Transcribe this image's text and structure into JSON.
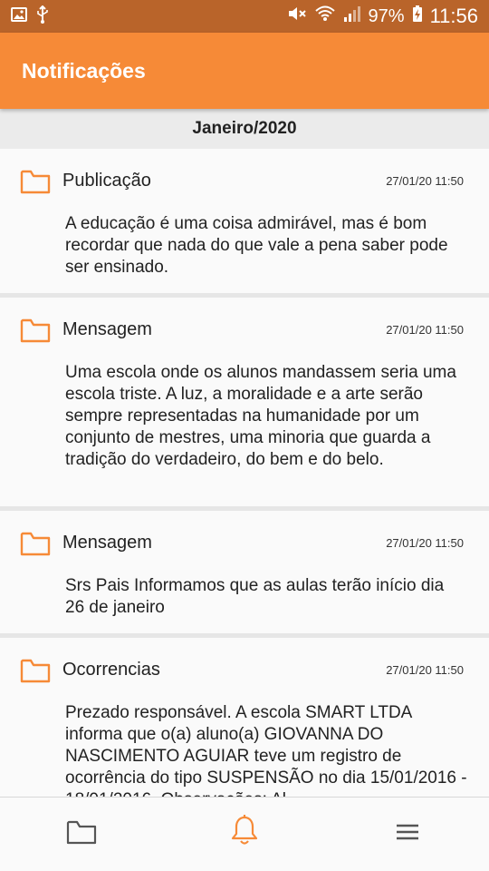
{
  "status_bar": {
    "battery_percent": "97%",
    "time": "11:56",
    "icons": [
      "image-icon",
      "usb-icon",
      "mute-icon",
      "wifi-icon",
      "signal-icon",
      "battery-charging-icon"
    ]
  },
  "app_bar": {
    "title": "Notificações",
    "color": "#f68a37"
  },
  "month_header": "Janeiro/2020",
  "notifications": [
    {
      "type": "Publicação",
      "date": "27/01/20 11:50",
      "icon": "folder-icon",
      "text": "A educação é uma coisa admirável, mas é bom recordar que nada do que vale a pena saber pode ser ensinado."
    },
    {
      "type": "Mensagem",
      "date": "27/01/20 11:50",
      "icon": "folder-icon",
      "text": "Uma escola onde os alunos mandassem seria uma escola triste. A luz, a moralidade e a arte serão sempre representadas na humanidade por um conjunto de mestres, uma minoria que guarda a tradição do verdadeiro, do bem e do belo."
    },
    {
      "type": "Mensagem",
      "date": "27/01/20 11:50",
      "icon": "folder-icon",
      "text": "Srs Pais Informamos que as aulas terão início dia 26 de janeiro"
    },
    {
      "type": "Ocorrencias",
      "date": "27/01/20 11:50",
      "icon": "folder-icon",
      "text": "Prezado responsável. A escola SMART LTDA informa que o(a) aluno(a) GIOVANNA DO NASCIMENTO AGUIAR teve um registro de ocorrência do tipo SUSPENSÃO no dia 15/01/2016 - 18/01/2016. Observações: Al"
    }
  ],
  "bottom_nav": {
    "items": [
      "folder-icon",
      "bell-icon",
      "menu-icon"
    ],
    "active": "bell-icon"
  },
  "colors": {
    "accent": "#f68a37",
    "status_bar": "#b9642a",
    "icon_inactive": "#555555"
  }
}
